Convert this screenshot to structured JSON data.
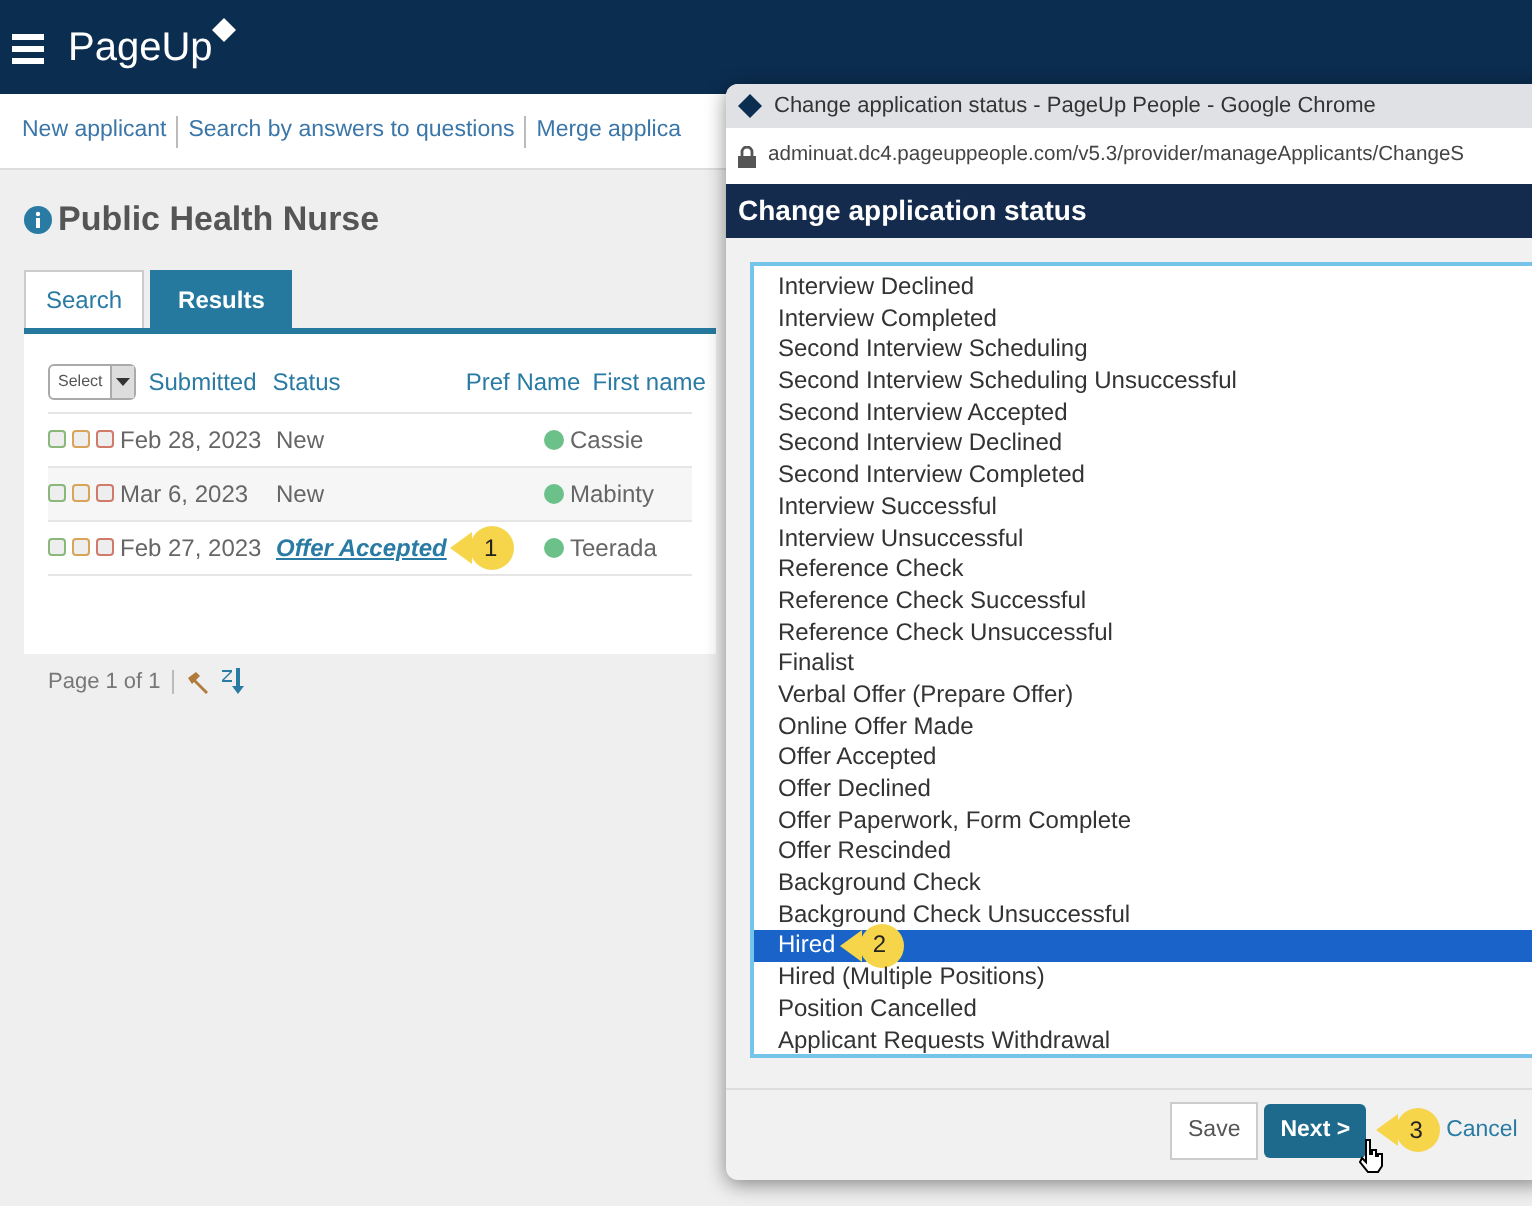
{
  "app": {
    "brand": "PageUp"
  },
  "links": [
    "New applicant",
    "Search by answers to questions",
    "Merge applica"
  ],
  "page_title": "Public Health Nurse",
  "tabs": [
    {
      "label": "Search",
      "selected": false
    },
    {
      "label": "Results",
      "selected": true
    }
  ],
  "table": {
    "select": "Select",
    "columns": [
      "Submitted",
      "Status",
      "Pref Name",
      "First name"
    ],
    "rows": [
      {
        "submitted": "Feb 28, 2023",
        "status": "New",
        "kind": "text",
        "flags": [
          {
            "checked": false
          },
          {
            "checked": false
          },
          {
            "checked": false
          }
        ],
        "first_name": "Cassie",
        "color": "#6cc18a"
      },
      {
        "submitted": "Mar 6, 2023",
        "status": "New",
        "kind": "text",
        "flags": [
          {
            "checked": false
          },
          {
            "checked": false
          },
          {
            "checked": false
          }
        ],
        "first_name": "Mabinty",
        "color": "#6cc18a"
      },
      {
        "submitted": "Feb 27, 2023",
        "status": "Offer Accepted",
        "kind": "link",
        "flags": [
          {
            "checked": false
          },
          {
            "checked": false
          },
          {
            "checked": false
          }
        ],
        "first_name": "Teerada",
        "color": "#6cc18a",
        "callout": "1"
      }
    ]
  },
  "pager": "Page 1 of 1",
  "popup": {
    "window_title": "Change application status - PageUp People - Google Chrome",
    "url": "adminuat.dc4.pageuppeople.com/v5.3/provider/manageApplicants/ChangeS",
    "header": "Change application status",
    "options": [
      {
        "label": "Interview Declined",
        "selected": false
      },
      {
        "label": "Interview Completed",
        "selected": false
      },
      {
        "label": "Second Interview Scheduling",
        "selected": false
      },
      {
        "label": "Second Interview Scheduling Unsuccessful",
        "selected": false
      },
      {
        "label": "Second Interview Accepted",
        "selected": false
      },
      {
        "label": "Second Interview Declined",
        "selected": false
      },
      {
        "label": "Second Interview Completed",
        "selected": false
      },
      {
        "label": "Interview Successful",
        "selected": false
      },
      {
        "label": "Interview Unsuccessful",
        "selected": false
      },
      {
        "label": "Reference Check",
        "selected": false
      },
      {
        "label": "Reference Check Successful",
        "selected": false
      },
      {
        "label": "Reference Check Unsuccessful",
        "selected": false
      },
      {
        "label": "Finalist",
        "selected": false
      },
      {
        "label": "Verbal Offer (Prepare Offer)",
        "selected": false
      },
      {
        "label": "Online Offer Made",
        "selected": false
      },
      {
        "label": "Offer Accepted",
        "selected": false
      },
      {
        "label": "Offer Declined",
        "selected": false
      },
      {
        "label": "Offer Paperwork, Form Complete",
        "selected": false
      },
      {
        "label": "Offer Rescinded",
        "selected": false
      },
      {
        "label": "Background Check",
        "selected": false
      },
      {
        "label": "Background Check Unsuccessful",
        "selected": false
      },
      {
        "label": "Hired",
        "selected": true,
        "callout": "2"
      },
      {
        "label": "Hired (Multiple Positions)",
        "selected": false
      },
      {
        "label": "Position Cancelled",
        "selected": false
      },
      {
        "label": "Applicant Requests Withdrawal",
        "selected": false
      }
    ],
    "buttons": {
      "save": "Save",
      "next": "Next >",
      "next_callout": "3",
      "cancel": "Cancel"
    }
  }
}
